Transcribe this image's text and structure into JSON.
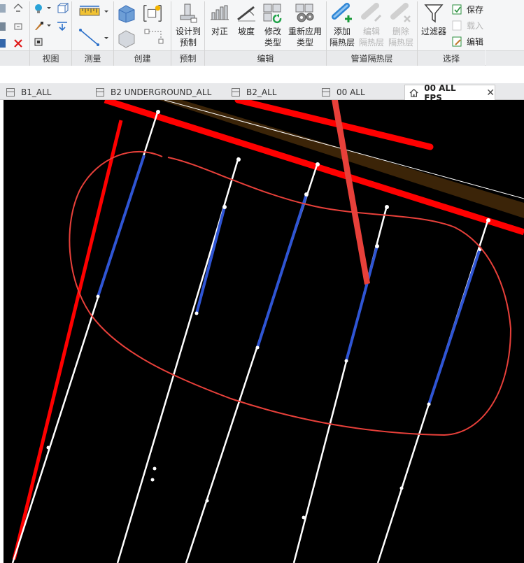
{
  "ribbon": {
    "panels": {
      "view": "视图",
      "measure": "测量",
      "create": "创建",
      "prefab": "预制",
      "edit": "编辑",
      "insulation": "管道隔热层",
      "select": "选择"
    },
    "tools": {
      "design_to_prefab": [
        "设计到",
        "预制"
      ],
      "align": "对正",
      "slope": "坡度",
      "modify_type": [
        "修改",
        "类型"
      ],
      "reapply_type": [
        "重新应用",
        "类型"
      ],
      "add_insulation": [
        "添加",
        "隔热层"
      ],
      "edit_insulation": [
        "编辑",
        "隔热层"
      ],
      "delete_insulation": [
        "删除",
        "隔热层"
      ],
      "filter": "过滤器",
      "save": "保存",
      "load": "载入",
      "edit_selection": "编辑"
    }
  },
  "tabs": [
    {
      "label": "B1_ALL",
      "active": false
    },
    {
      "label": "B2 UNDERGROUND_ALL",
      "active": false
    },
    {
      "label": "B2_ALL",
      "active": false
    },
    {
      "label": "00 ALL",
      "active": false
    },
    {
      "label": "00 ALL FPS",
      "active": true
    }
  ],
  "tab_close": "✕",
  "colors": {
    "canvas": "#000000",
    "pipe_red": "#ff0000",
    "pipe_blue": "#2f55d4",
    "duct_brown": "#3b2408",
    "annotation": "#e8403a",
    "arrow": "#e8403a"
  }
}
